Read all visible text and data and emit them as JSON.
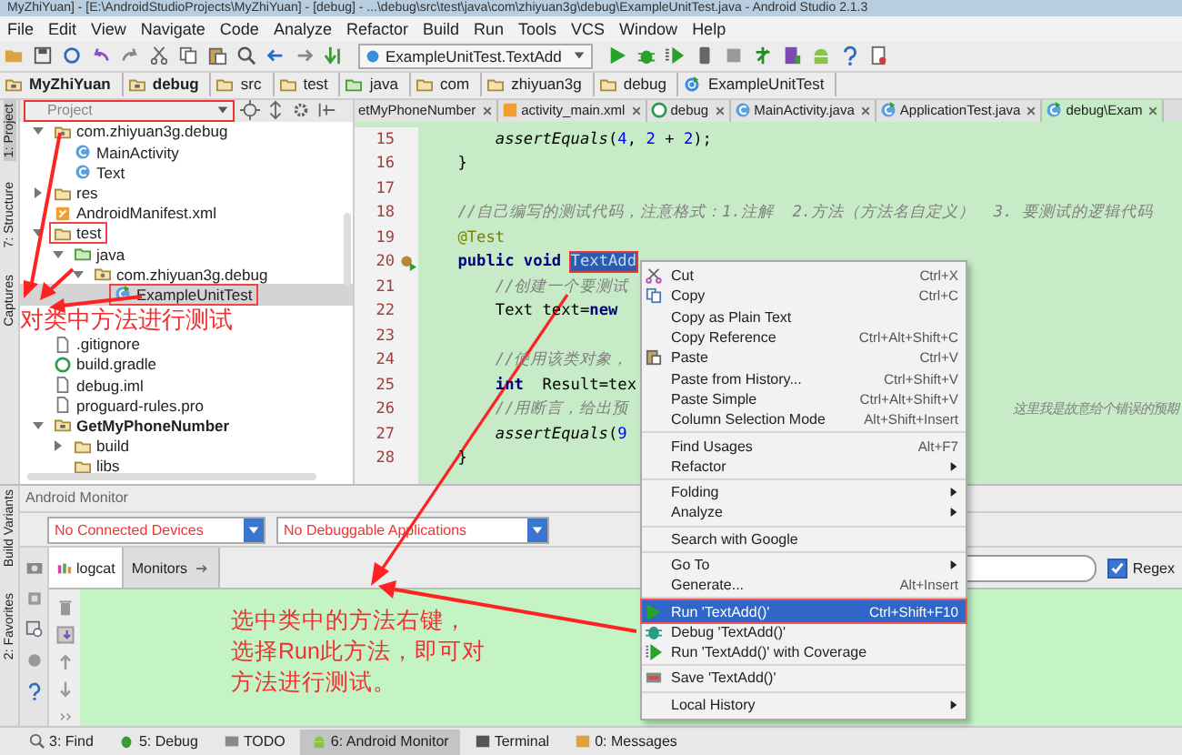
{
  "window": {
    "title": "MyZhiYuan] - [E:\\AndroidStudioProjects\\MyZhiYuan] - [debug] - ...\\debug\\src\\test\\java\\com\\zhiyuan3g\\debug\\ExampleUnitTest.java - Android Studio 2.1.3"
  },
  "menu_bar": [
    "File",
    "Edit",
    "View",
    "Navigate",
    "Code",
    "Analyze",
    "Refactor",
    "Build",
    "Run",
    "Tools",
    "VCS",
    "Window",
    "Help"
  ],
  "toolbar": {
    "run_config": "ExampleUnitTest.TextAdd"
  },
  "breadcrumbs": [
    {
      "label": "MyZhiYuan",
      "kind": "module"
    },
    {
      "label": "debug",
      "kind": "module"
    },
    {
      "label": "src",
      "kind": "folder"
    },
    {
      "label": "test",
      "kind": "folder"
    },
    {
      "label": "java",
      "kind": "source"
    },
    {
      "label": "com",
      "kind": "folder"
    },
    {
      "label": "zhiyuan3g",
      "kind": "folder"
    },
    {
      "label": "debug",
      "kind": "folder"
    },
    {
      "label": "ExampleUnitTest",
      "kind": "test"
    }
  ],
  "side_tabs_top": [
    {
      "label": "1: Project",
      "selected": true
    },
    {
      "label": "7: Structure",
      "selected": false
    },
    {
      "label": "Captures",
      "selected": false
    }
  ],
  "project_panel": {
    "view": "Project",
    "tree": [
      {
        "label": "com.zhiyuan3g.debug",
        "kind": "package",
        "expanded": true,
        "selected": false,
        "boxed": false,
        "children": [
          {
            "label": "MainActivity",
            "kind": "class",
            "selected": false,
            "boxed": false
          },
          {
            "label": "Text",
            "kind": "class",
            "selected": false,
            "boxed": false
          }
        ]
      },
      {
        "label": "res",
        "kind": "folder",
        "expanded": false,
        "selected": false,
        "boxed": false
      },
      {
        "label": "AndroidManifest.xml",
        "kind": "xml",
        "selected": false,
        "boxed": false
      },
      {
        "label": "test",
        "kind": "folder",
        "expanded": true,
        "selected": false,
        "boxed": true,
        "children": [
          {
            "label": "java",
            "kind": "source",
            "expanded": true,
            "selected": false,
            "boxed": false,
            "children": [
              {
                "label": "com.zhiyuan3g.debug",
                "kind": "package",
                "expanded": true,
                "selected": false,
                "boxed": false,
                "children": [
                  {
                    "label": "ExampleUnitTest",
                    "kind": "test",
                    "selected": true,
                    "boxed": true
                  }
                ]
              }
            ]
          }
        ]
      },
      {
        "label": ".gitignore",
        "kind": "file",
        "selected": false,
        "boxed": false
      },
      {
        "label": "build.gradle",
        "kind": "gradle",
        "selected": false,
        "boxed": false
      },
      {
        "label": "debug.iml",
        "kind": "file",
        "selected": false,
        "boxed": false
      },
      {
        "label": "proguard-rules.pro",
        "kind": "file",
        "selected": false,
        "boxed": false
      },
      {
        "label": "GetMyPhoneNumber",
        "kind": "module",
        "expanded": true,
        "selected": false,
        "boxed": false,
        "children": [
          {
            "label": "build",
            "kind": "folder",
            "expanded": false,
            "selected": false,
            "boxed": false
          },
          {
            "label": "libs",
            "kind": "folder",
            "selected": false,
            "boxed": false
          }
        ]
      }
    ]
  },
  "editor": {
    "tabs": [
      {
        "label": "etMyPhoneNumber",
        "kind": "plain",
        "selected": false
      },
      {
        "label": "activity_main.xml",
        "kind": "xml",
        "selected": false
      },
      {
        "label": "debug",
        "kind": "gradle",
        "selected": false
      },
      {
        "label": "MainActivity.java",
        "kind": "class",
        "selected": false
      },
      {
        "label": "ApplicationTest.java",
        "kind": "test",
        "selected": false
      },
      {
        "label": "debug\\Exam",
        "kind": "test",
        "selected": true
      }
    ],
    "lines": [
      {
        "number": "15",
        "segments": [
          {
            "text": "        assertEquals",
            "kind": "italic"
          },
          {
            "text": "(",
            "kind": "plain"
          },
          {
            "text": "4",
            "kind": "number"
          },
          {
            "text": ", ",
            "kind": "plain"
          },
          {
            "text": "2",
            "kind": "number"
          },
          {
            "text": " + ",
            "kind": "plain"
          },
          {
            "text": "2",
            "kind": "number"
          },
          {
            "text": ");",
            "kind": "plain"
          }
        ]
      },
      {
        "number": "16",
        "segments": [
          {
            "text": "    }",
            "kind": "plain"
          }
        ]
      },
      {
        "number": "17"
      },
      {
        "number": "18",
        "segments": [
          {
            "text": "    //自己编写的测试代码，注意格式：1.注解  2.方法（方法名自定义）  3. 要测试的逻辑代码",
            "kind": "comment"
          }
        ]
      },
      {
        "number": "19",
        "segments": [
          {
            "text": "    @Test",
            "kind": "annotation"
          }
        ]
      },
      {
        "number": "20",
        "run_marker": true,
        "segments": [
          {
            "text": "    public void ",
            "kind": "keyword"
          },
          {
            "text": "TextAdd",
            "kind": "selection"
          }
        ]
      },
      {
        "number": "21",
        "segments": [
          {
            "text": "        //创建一个要测试",
            "kind": "comment"
          }
        ]
      },
      {
        "number": "22",
        "segments": [
          {
            "text": "        Text text=",
            "kind": "plain"
          },
          {
            "text": "new",
            "kind": "keyword"
          }
        ]
      },
      {
        "number": "23"
      },
      {
        "number": "24",
        "segments": [
          {
            "text": "        //使用该类对象，",
            "kind": "comment"
          }
        ]
      },
      {
        "number": "25",
        "segments": [
          {
            "text": "        int",
            "kind": "keyword"
          },
          {
            "text": "  Result=tex",
            "kind": "plain"
          }
        ]
      },
      {
        "number": "26",
        "segments": [
          {
            "text": "        //用断言，给出预",
            "kind": "comment"
          }
        ],
        "tail": "这里我是故意给个错误的预期"
      },
      {
        "number": "27",
        "segments": [
          {
            "text": "        assertEquals",
            "kind": "italic"
          },
          {
            "text": "(",
            "kind": "plain"
          },
          {
            "text": "9",
            "kind": "number"
          }
        ]
      },
      {
        "number": "28",
        "segments": [
          {
            "text": "    }",
            "kind": "plain"
          }
        ]
      }
    ]
  },
  "context_menu": {
    "groups": [
      [
        {
          "label": "Cut",
          "shortcut": "Ctrl+X",
          "kind": "cut",
          "submenu": false,
          "selected": false
        },
        {
          "label": "Copy",
          "shortcut": "Ctrl+C",
          "kind": "copy",
          "submenu": false,
          "selected": false
        },
        {
          "label": "Copy as Plain Text",
          "kind": "plain",
          "submenu": false,
          "selected": false
        },
        {
          "label": "Copy Reference",
          "shortcut": "Ctrl+Alt+Shift+C",
          "kind": "plain",
          "submenu": false,
          "selected": false
        },
        {
          "label": "Paste",
          "shortcut": "Ctrl+V",
          "kind": "paste",
          "submenu": false,
          "selected": false
        },
        {
          "label": "Paste from History...",
          "shortcut": "Ctrl+Shift+V",
          "kind": "plain",
          "submenu": false,
          "selected": false
        },
        {
          "label": "Paste Simple",
          "shortcut": "Ctrl+Alt+Shift+V",
          "kind": "plain",
          "submenu": false,
          "selected": false
        },
        {
          "label": "Column Selection Mode",
          "shortcut": "Alt+Shift+Insert",
          "kind": "plain",
          "submenu": false,
          "selected": false
        }
      ],
      [
        {
          "label": "Find Usages",
          "shortcut": "Alt+F7",
          "kind": "plain",
          "submenu": false,
          "selected": false
        },
        {
          "label": "Refactor",
          "kind": "plain",
          "submenu": true,
          "selected": false
        }
      ],
      [
        {
          "label": "Folding",
          "kind": "plain",
          "submenu": true,
          "selected": false
        },
        {
          "label": "Analyze",
          "kind": "plain",
          "submenu": true,
          "selected": false
        }
      ],
      [
        {
          "label": "Search with Google",
          "kind": "plain",
          "submenu": false,
          "selected": false
        }
      ],
      [
        {
          "label": "Go To",
          "kind": "plain",
          "submenu": true,
          "selected": false
        },
        {
          "label": "Generate...",
          "shortcut": "Alt+Insert",
          "kind": "plain",
          "submenu": false,
          "selected": false
        }
      ],
      [
        {
          "label": "Run 'TextAdd()'",
          "shortcut": "Ctrl+Shift+F10",
          "kind": "run",
          "submenu": false,
          "selected": true
        },
        {
          "label": "Debug 'TextAdd()'",
          "kind": "debug",
          "submenu": false,
          "selected": false
        },
        {
          "label": "Run 'TextAdd()' with Coverage",
          "kind": "coverage",
          "submenu": false,
          "selected": false
        }
      ],
      [
        {
          "label": "Save 'TextAdd()'",
          "kind": "save",
          "submenu": false,
          "selected": false
        }
      ],
      [
        {
          "label": "Local History",
          "kind": "plain",
          "submenu": true,
          "selected": false
        }
      ]
    ]
  },
  "side_tabs_bottom": [
    {
      "label": "Build Variants",
      "selected": false
    },
    {
      "label": "2: Favorites",
      "selected": false
    }
  ],
  "android_monitor": {
    "title": "Android Monitor",
    "device": "No Connected Devices",
    "app": "No Debuggable Applications",
    "tabs": [
      {
        "label": "logcat",
        "selected": true
      },
      {
        "label": "Monitors",
        "selected": false
      }
    ],
    "regex": {
      "label": "Regex",
      "checked": true
    }
  },
  "annotations": {
    "tree_note": "对类中方法进行测试",
    "log_note": [
      "选中类中的方法右键，",
      "选择Run此方法，即可对",
      "方法进行测试。"
    ]
  },
  "tool_windows": [
    {
      "label": "3: Find",
      "kind": "find",
      "selected": false
    },
    {
      "label": "5: Debug",
      "kind": "debug",
      "selected": false
    },
    {
      "label": "TODO",
      "kind": "todo",
      "selected": false
    },
    {
      "label": "6: Android Monitor",
      "kind": "android",
      "selected": true
    },
    {
      "label": "Terminal",
      "kind": "terminal",
      "selected": false
    },
    {
      "label": "0: Messages",
      "kind": "messages",
      "selected": false
    }
  ]
}
